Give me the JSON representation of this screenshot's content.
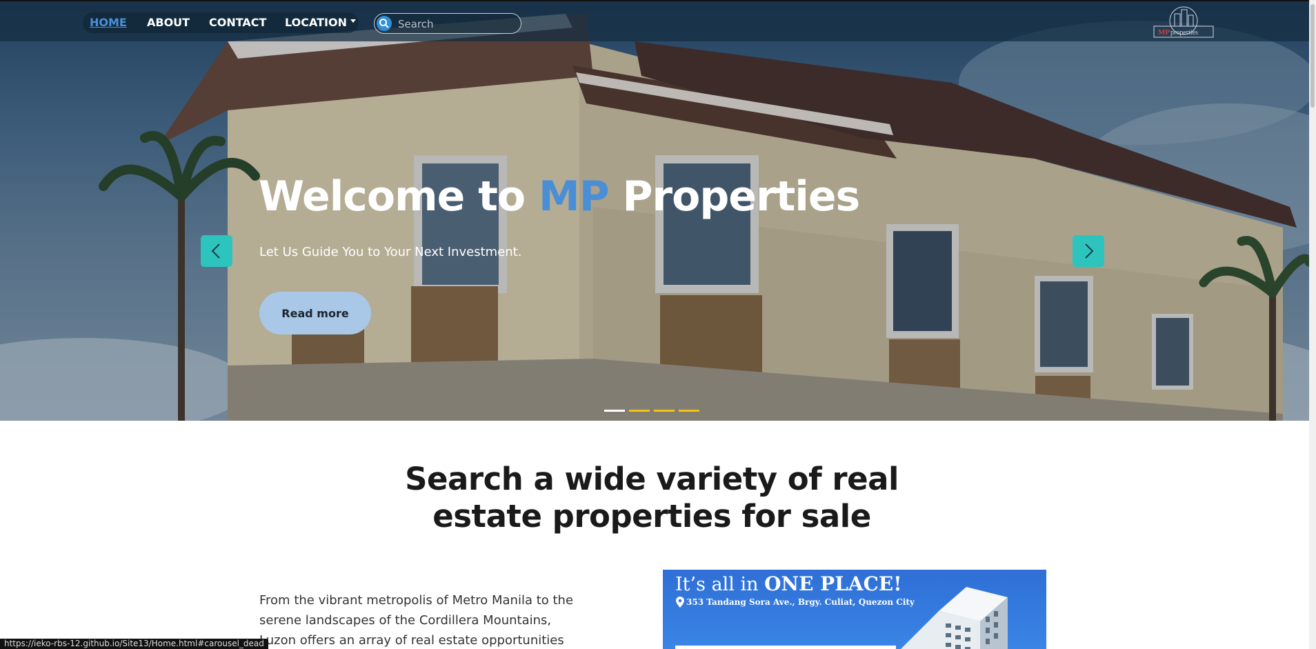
{
  "nav": {
    "items": [
      {
        "label": "HOME",
        "active": true
      },
      {
        "label": "ABOUT",
        "active": false
      },
      {
        "label": "CONTACT",
        "active": false
      },
      {
        "label": "LOCATION",
        "active": false
      }
    ],
    "search_placeholder": "Search",
    "logo_text": "MPproperties",
    "logo_mp": "MP"
  },
  "hero": {
    "title_pre": "Welcome to ",
    "title_accent": "MP",
    "title_post": " Properties",
    "subtitle": "Let Us Guide You to Your Next Investment.",
    "cta_label": "Read more",
    "slides_count": 4,
    "active_slide": 1
  },
  "colors": {
    "accent": "#4a8fd6",
    "carousel_button": "#2ec4be",
    "indicator_active": "#ffffff",
    "indicator_inactive": "#f1c40f",
    "cta_bg": "#a9c7e6"
  },
  "section": {
    "title_line1": "Search a wide variety of real",
    "title_line2": "estate properties for sale",
    "body": "From the vibrant metropolis of Metro Manila to the serene landscapes of the Cordillera Mountains, Luzon offers an array of real estate opportunities waiting to"
  },
  "promo": {
    "headline_pre": "It’s all in ",
    "headline_bold": "ONE PLACE!",
    "address": "353 Tandang Sora Ave., Brgy. Culiat, Quezon City"
  },
  "status_bar": "https://ieko-rbs-12.github.io/Site13/Home.html#carousel_dead"
}
